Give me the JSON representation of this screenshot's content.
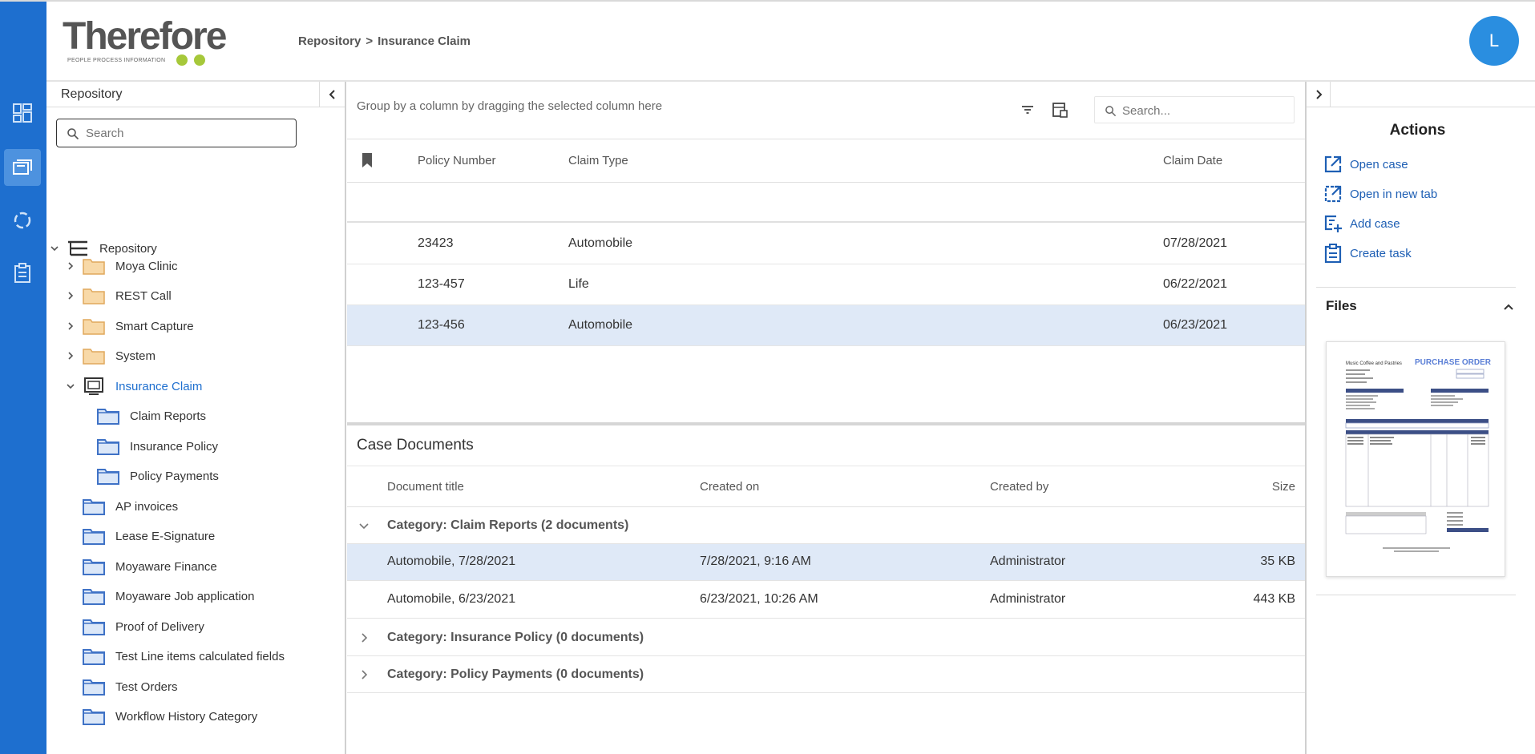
{
  "header": {
    "logo_text": "Therefore",
    "logo_tagline": "PEOPLE  PROCESS  INFORMATION",
    "breadcrumb": [
      "Repository",
      "Insurance Claim"
    ],
    "breadcrumb_sep": ">",
    "avatar_initial": "L"
  },
  "rail": {
    "items": [
      {
        "name": "dashboard-icon",
        "active": false
      },
      {
        "name": "repository-icon",
        "active": true
      },
      {
        "name": "workflow-icon",
        "active": false
      },
      {
        "name": "tasks-icon",
        "active": false
      }
    ]
  },
  "tree": {
    "title": "Repository",
    "search_placeholder": "Search",
    "root": "Repository",
    "items": [
      {
        "label": "Moya Clinic",
        "type": "folder"
      },
      {
        "label": "REST Call",
        "type": "folder"
      },
      {
        "label": "Smart Capture",
        "type": "folder"
      },
      {
        "label": "System",
        "type": "folder"
      },
      {
        "label": "Insurance Claim",
        "type": "case"
      },
      {
        "label": "Claim Reports",
        "type": "category"
      },
      {
        "label": "Insurance Policy",
        "type": "category"
      },
      {
        "label": "Policy Payments",
        "type": "category"
      },
      {
        "label": "AP invoices",
        "type": "category"
      },
      {
        "label": "Lease E-Signature",
        "type": "category"
      },
      {
        "label": "Moyaware Finance",
        "type": "category"
      },
      {
        "label": "Moyaware Job application",
        "type": "category"
      },
      {
        "label": "Proof of Delivery",
        "type": "category"
      },
      {
        "label": "Test Line items calculated fields",
        "type": "category"
      },
      {
        "label": "Test Orders",
        "type": "category"
      },
      {
        "label": "Workflow History Category",
        "type": "category"
      }
    ]
  },
  "grid": {
    "group_hint": "Group by a column by dragging the selected column here",
    "search_placeholder": "Search...",
    "columns": [
      "Policy Number",
      "Claim Type",
      "Claim Date"
    ],
    "rows": [
      {
        "policy": "23423",
        "type": "Automobile",
        "date": "07/28/2021",
        "selected": false
      },
      {
        "policy": "123-457",
        "type": "Life",
        "date": "06/22/2021",
        "selected": false
      },
      {
        "policy": "123-456",
        "type": "Automobile",
        "date": "06/23/2021",
        "selected": true
      }
    ]
  },
  "documents": {
    "title": "Case Documents",
    "columns": [
      "Document title",
      "Created on",
      "Created by",
      "Size"
    ],
    "categories": [
      {
        "label": "Category: Claim Reports (2 documents)",
        "expanded": true,
        "docs": [
          {
            "title": "Automobile, 7/28/2021",
            "created_on": "7/28/2021, 9:16 AM",
            "created_by": "Administrator",
            "size": "35 KB",
            "selected": true
          },
          {
            "title": "Automobile, 6/23/2021",
            "created_on": "6/23/2021, 10:26 AM",
            "created_by": "Administrator",
            "size": "443 KB",
            "selected": false
          }
        ]
      },
      {
        "label": "Category: Insurance Policy (0 documents)",
        "expanded": false,
        "docs": []
      },
      {
        "label": "Category: Policy Payments (0 documents)",
        "expanded": false,
        "docs": []
      }
    ]
  },
  "actions": {
    "title": "Actions",
    "items": [
      "Open case",
      "Open in new tab",
      "Add case",
      "Create task"
    ]
  },
  "files": {
    "title": "Files",
    "preview_heading": "PURCHASE ORDER",
    "preview_company": "Music Coffee and Pastries"
  },
  "colors": {
    "accent": "#1e6fcf",
    "selection": "#dfe9f7",
    "logo_green": "#a6c83a"
  }
}
